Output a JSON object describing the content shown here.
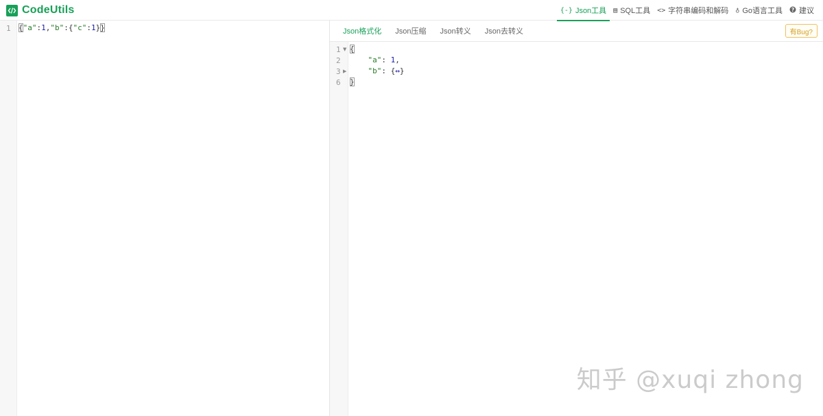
{
  "app": {
    "logo_bold": "Code",
    "logo_rest": "Utils"
  },
  "nav": [
    {
      "icon": "{-}",
      "label": "Json工具",
      "active": true
    },
    {
      "icon": "▤",
      "label": "SQL工具",
      "active": false
    },
    {
      "icon": "<>",
      "label": "字符串编码和解码",
      "active": false
    },
    {
      "icon": "♁",
      "label": "Go语言工具",
      "active": false
    },
    {
      "icon": "?",
      "label": "建议",
      "active": false
    }
  ],
  "left_editor": {
    "line_numbers": [
      "1"
    ],
    "code_line_1": {
      "open": "{",
      "k1": "\"a\"",
      "c1": ":",
      "v1": "1",
      "comma1": ",",
      "k2": "\"b\"",
      "c2": ":",
      "open2": "{",
      "k3": "\"c\"",
      "c3": ":",
      "v3": "1",
      "close2": "}",
      "close": "}"
    }
  },
  "tabs": [
    {
      "label": "Json格式化",
      "active": true
    },
    {
      "label": "Json压缩",
      "active": false
    },
    {
      "label": "Json转义",
      "active": false
    },
    {
      "label": "Json去转义",
      "active": false
    }
  ],
  "bug_button": "有Bug?",
  "right_editor": {
    "line_numbers": [
      "1",
      "2",
      "3",
      "6"
    ],
    "lines": {
      "l1_open": "{",
      "l2_key": "\"a\"",
      "l2_colon": ": ",
      "l2_val": "1",
      "l2_comma": ",",
      "l3_key": "\"b\"",
      "l3_colon": ": ",
      "l3_open": "{",
      "l3_marker": "↔",
      "l3_close": "}",
      "l6_close": "}"
    }
  },
  "watermark": "知乎 @xuqi zhong",
  "colors": {
    "accent": "#18a058",
    "string": "#2a7a2a",
    "number": "#1a1aa6",
    "bug_border": "#f0c060"
  }
}
